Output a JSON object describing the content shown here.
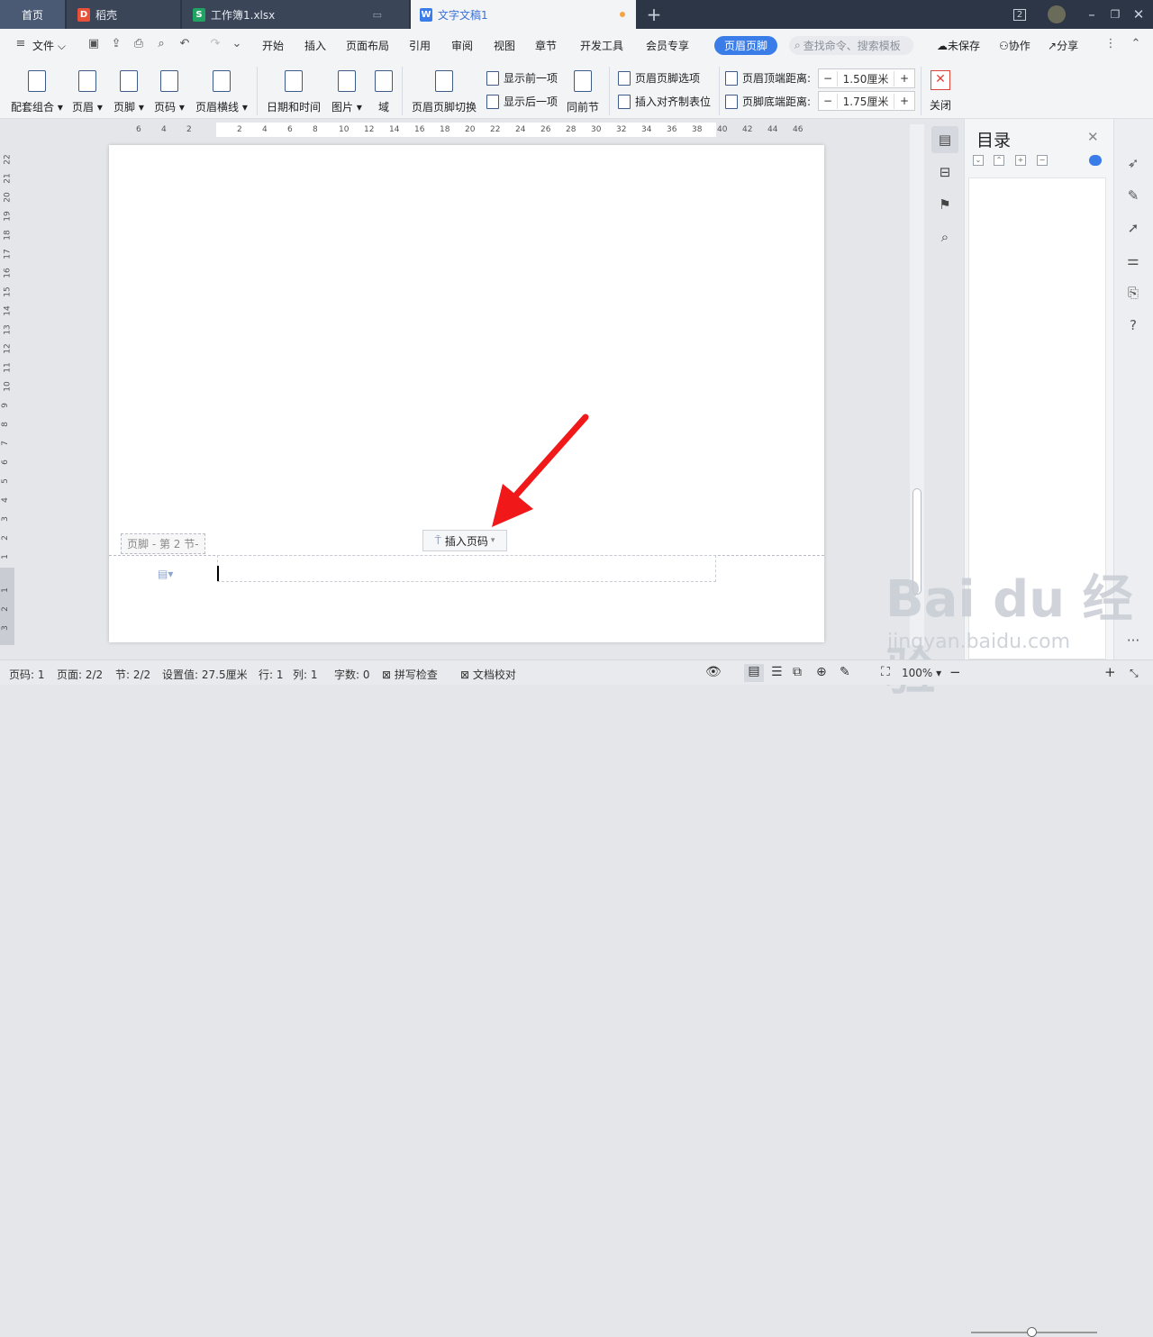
{
  "tabs": {
    "home": "首页",
    "daoke": "稻壳",
    "excel": "工作簿1.xlsx",
    "doc": "文字文稿1",
    "badge": "2"
  },
  "menu": {
    "file": "文件",
    "items": [
      "开始",
      "插入",
      "页面布局",
      "引用",
      "审阅",
      "视图",
      "章节",
      "开发工具",
      "会员专享"
    ],
    "active": "页眉页脚",
    "search_placeholder": "查找命令、搜索模板",
    "unsaved": "未保存",
    "collab": "协作",
    "share": "分享"
  },
  "ribbon": {
    "set_combo": "配套组合",
    "header": "页眉",
    "footer": "页脚",
    "page_number": "页码",
    "header_line": "页眉横线",
    "datetime": "日期和时间",
    "picture": "图片",
    "field": "域",
    "switch": "页眉页脚切换",
    "prev": "显示前一项",
    "next": "显示后一项",
    "same_prev": "同前节",
    "options": "页眉页脚选项",
    "insert_tab": "插入对齐制表位",
    "header_top_label": "页眉顶端距离:",
    "header_top_value": "1.50厘米",
    "footer_bottom_label": "页脚底端距离:",
    "footer_bottom_value": "1.75厘米",
    "close": "关闭"
  },
  "ruler": {
    "h": [
      "6",
      "4",
      "2",
      "2",
      "4",
      "6",
      "8",
      "10",
      "12",
      "14",
      "16",
      "18",
      "20",
      "22",
      "24",
      "26",
      "28",
      "30",
      "32",
      "34",
      "36",
      "38",
      "40",
      "42",
      "44",
      "46"
    ],
    "v": [
      "22",
      "21",
      "20",
      "19",
      "18",
      "17",
      "16",
      "15",
      "14",
      "13",
      "12",
      "11",
      "10",
      "9",
      "8",
      "7",
      "6",
      "5",
      "4",
      "3",
      "2",
      "1",
      "1",
      "2",
      "3"
    ]
  },
  "document": {
    "footer_label": "页脚 - 第 2 节-",
    "insert_page_number": "插入页码"
  },
  "toc": {
    "title": "目录"
  },
  "status": {
    "page": "页码: 1",
    "pages": "页面: 2/2",
    "section": "节: 2/2",
    "setting": "设置值: 27.5厘米",
    "row": "行: 1",
    "col": "列: 1",
    "words": "字数: 0",
    "spell": "拼写检查",
    "proof": "文档校对",
    "zoom": "100%"
  },
  "watermark": {
    "brand": "Bai du 经验",
    "url": "jingyan.baidu.com"
  },
  "colors": {
    "accent": "#3b7de8",
    "tabbar": "#2c3646",
    "arrow": "#f01818"
  }
}
